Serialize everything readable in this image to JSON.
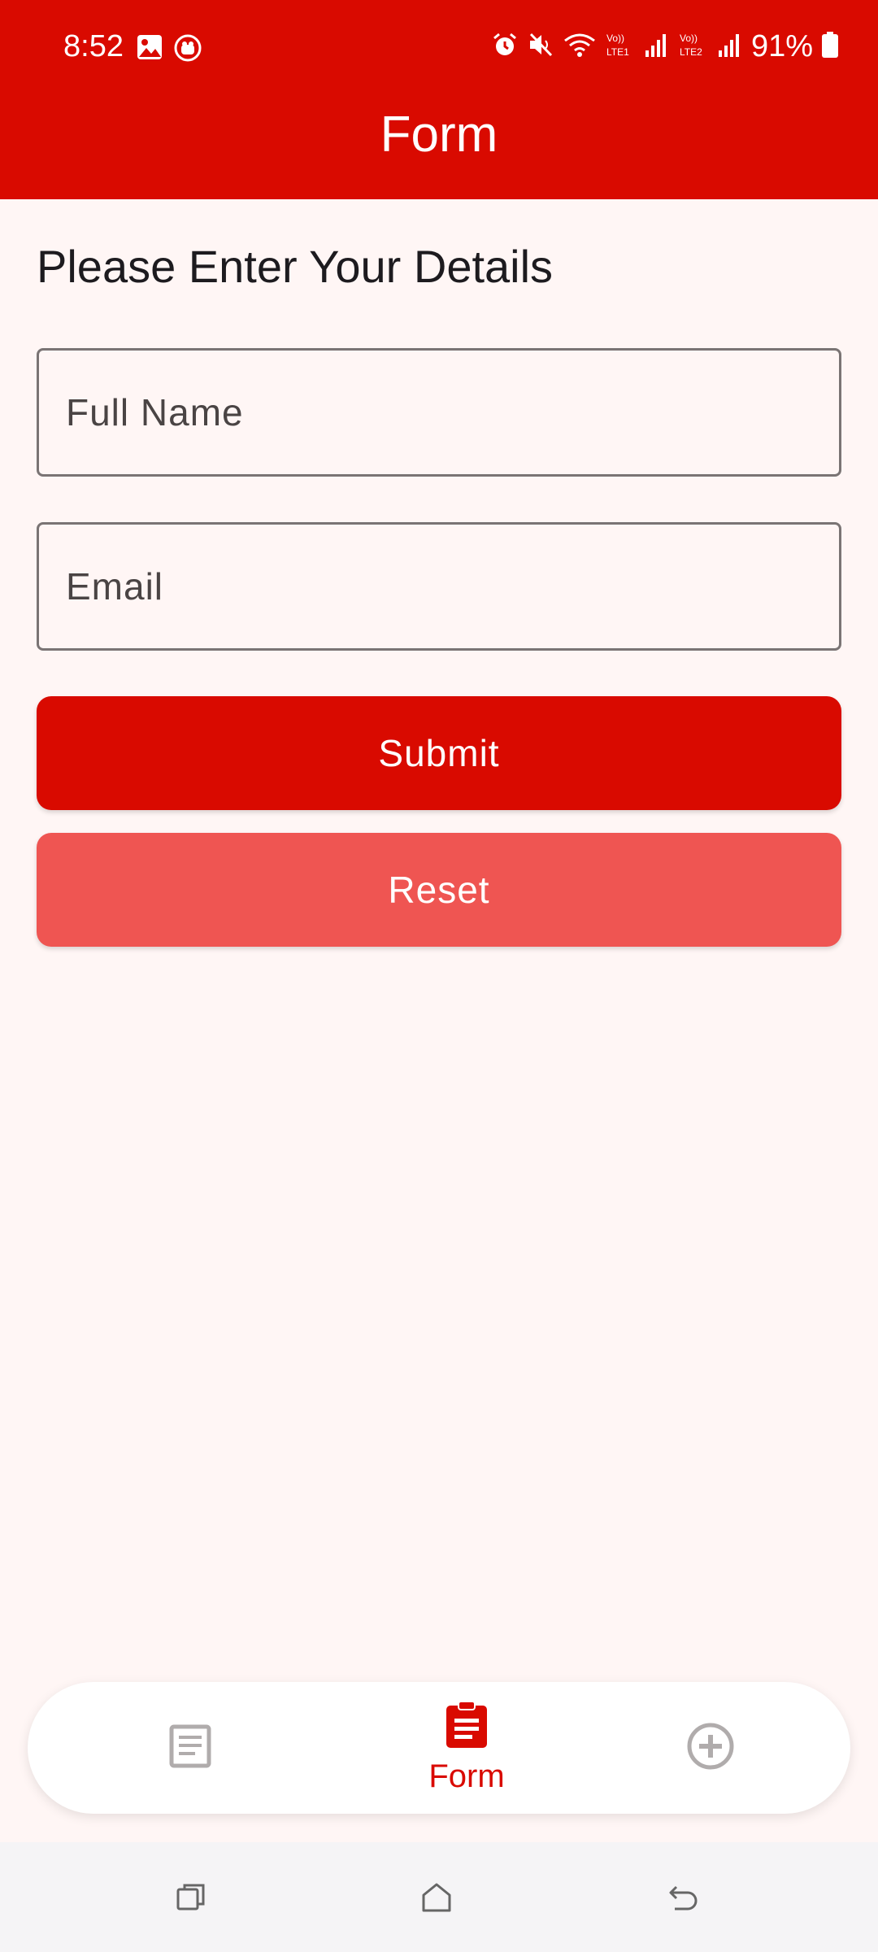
{
  "status_bar": {
    "time": "8:52",
    "battery": "91%",
    "left_icons": [
      "image-icon",
      "app-notification-icon"
    ],
    "right_icons": [
      "alarm-icon",
      "mute-icon",
      "wifi-icon",
      "volte-lte1-signal-icon",
      "volte-lte2-signal-icon",
      "battery-icon"
    ]
  },
  "app_bar": {
    "title": "Form"
  },
  "form": {
    "heading": "Please Enter Your Details",
    "full_name_placeholder": "Full Name",
    "email_placeholder": "Email",
    "submit_label": "Submit",
    "reset_label": "Reset"
  },
  "bottom_nav": {
    "items": [
      {
        "icon": "list-icon",
        "label": "",
        "active": false
      },
      {
        "icon": "clipboard-icon",
        "label": "Form",
        "active": true
      },
      {
        "icon": "add-circle-icon",
        "label": "",
        "active": false
      }
    ]
  },
  "colors": {
    "primary": "#d90a00",
    "reset_button": "#ef5552",
    "background": "#fff6f5",
    "inactive_icon": "#b0acac"
  }
}
